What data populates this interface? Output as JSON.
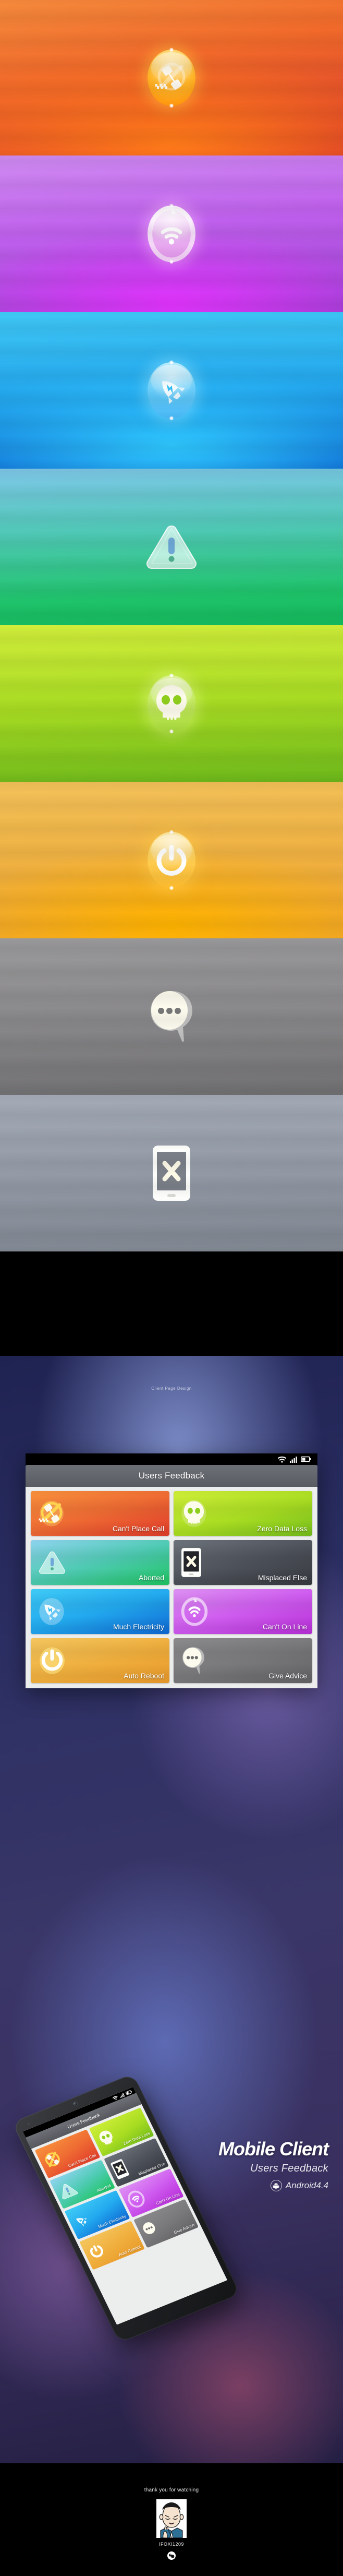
{
  "hero_panels": [
    {
      "key": "no-call",
      "icon": "no-call-icon",
      "bg": "#f26a2a",
      "accent": "#ffb31e"
    },
    {
      "key": "wifi",
      "icon": "wifi-icon",
      "bg": "#c060ee",
      "accent": "#ffd7f0"
    },
    {
      "key": "rocket",
      "icon": "rocket-icon",
      "bg": "#24a8ee",
      "accent": "#a0e8ff"
    },
    {
      "key": "warning",
      "icon": "warning-icon",
      "bg": "#1ec46a",
      "accent": "#d7f7ee"
    },
    {
      "key": "skull",
      "icon": "skull-icon",
      "bg": "#a8dc23",
      "accent": "#fffbe8"
    },
    {
      "key": "power",
      "icon": "power-icon",
      "bg": "#f0b141",
      "accent": "#ffc83f"
    },
    {
      "key": "speech",
      "icon": "speech-icon",
      "bg": "#8b8a8c",
      "accent": "#fdfbf0"
    },
    {
      "key": "phone-x",
      "icon": "phone-x-icon",
      "bg": "#959ca8",
      "accent": "#ffffff"
    }
  ],
  "deck": {
    "label": "Client Page Design"
  },
  "app": {
    "status_bar": {
      "wifi": "wifi-icon",
      "signal": "signal-icon",
      "battery": "battery-icon"
    },
    "title": "Users Feedback",
    "tiles": [
      {
        "label": "Can't Place Call",
        "icon": "no-call-icon",
        "theme": "t-orange"
      },
      {
        "label": "Zero Data Loss",
        "icon": "skull-icon",
        "theme": "t-lime"
      },
      {
        "label": "Aborted",
        "icon": "warning-icon",
        "theme": "t-teal"
      },
      {
        "label": "Misplaced Else",
        "icon": "phone-x-icon",
        "theme": "t-dark"
      },
      {
        "label": "Much Electricity",
        "icon": "rocket-icon",
        "theme": "t-blue"
      },
      {
        "label": "Can't On Line",
        "icon": "wifi-icon",
        "theme": "t-purple"
      },
      {
        "label": "Auto Reboot",
        "icon": "power-icon",
        "theme": "t-amber"
      },
      {
        "label": "Give Advice",
        "icon": "speech-icon",
        "theme": "t-gray"
      }
    ]
  },
  "showcase": {
    "title": "Mobile Client",
    "subtitle": "Users Feedback",
    "os": "Android4.4",
    "os_icon": "android-icon",
    "phone_title": "Users Feedback"
  },
  "footer": {
    "thanks": "thank you for watching",
    "avatar": "avatar-illustration",
    "handle": "IFOXI1209",
    "brand": "brand-logo-icon"
  }
}
